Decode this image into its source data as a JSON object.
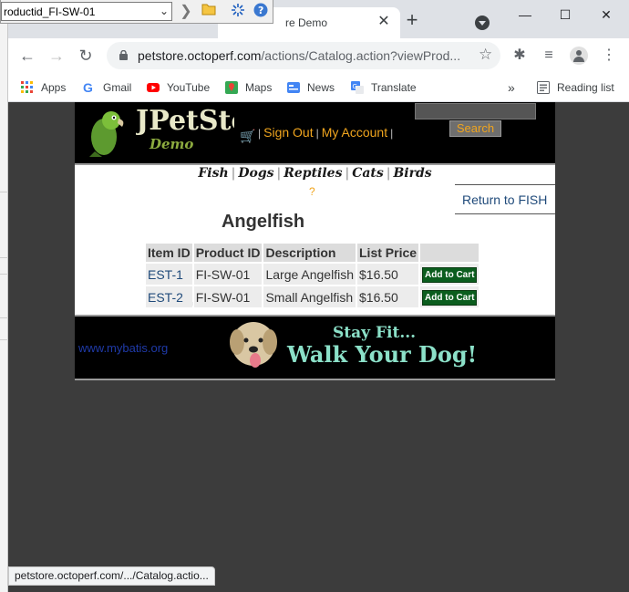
{
  "overlay": {
    "combo_value": "roductid_FI-SW-01"
  },
  "browser": {
    "tab_title": "re Demo",
    "url_host": "petstore.octoperf.com",
    "url_path": "/actions/Catalog.action?viewProd...",
    "bookmarks": [
      "Apps",
      "Gmail",
      "YouTube",
      "Maps",
      "News",
      "Translate"
    ],
    "reading_list": "Reading list",
    "status_url": "petstore.octoperf.com/.../Catalog.actio..."
  },
  "site": {
    "logo": "JPetStore",
    "logo_sub": "Demo",
    "sign_out": "Sign Out",
    "my_account": "My Account",
    "search_button": "Search",
    "categories": [
      "Fish",
      "Dogs",
      "Reptiles",
      "Cats",
      "Birds"
    ],
    "help": "?",
    "back_link": "Return to FISH",
    "product_title": "Angelfish",
    "table_headers": [
      "Item ID",
      "Product ID",
      "Description",
      "List Price"
    ],
    "rows": [
      {
        "item_id": "EST-1",
        "product_id": "FI-SW-01",
        "description": "Large Angelfish",
        "price": "$16.50",
        "button": "Add to Cart"
      },
      {
        "item_id": "EST-2",
        "product_id": "FI-SW-01",
        "description": "Small Angelfish",
        "price": "$16.50",
        "button": "Add to Cart"
      }
    ],
    "footer_link": "www.mybatis.org",
    "slogan_line1": "Stay Fit...",
    "slogan_line2": "Walk Your Dog!"
  },
  "colors": {
    "accent_orange": "#f0a51e",
    "header_bg": "#000000",
    "add_button": "#0b5d1e"
  }
}
